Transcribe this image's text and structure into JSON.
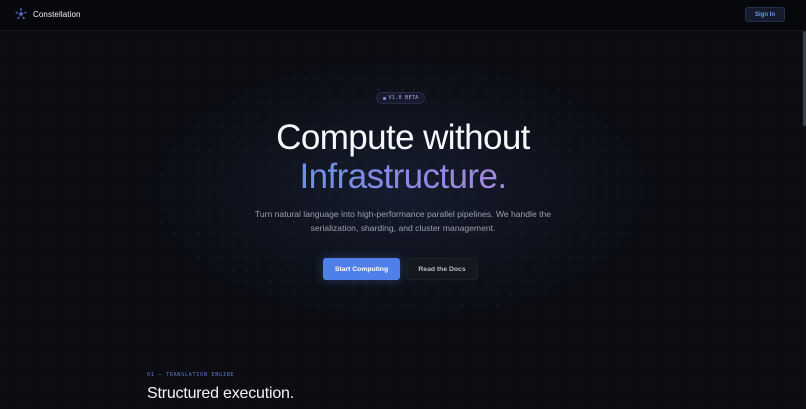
{
  "nav": {
    "brand_name": "Constellation",
    "brand_icon": "constellation-icon",
    "signin_label": "Sign In"
  },
  "hero": {
    "badge_text": "V1.0 BETA",
    "headline_line1": "Compute without",
    "headline_line2": "Infrastructure.",
    "subtext": "Turn natural language into high-performance parallel pipelines. We handle the serialization, sharding, and cluster management.",
    "primary_cta": "Start Computing",
    "secondary_cta": "Read the Docs"
  },
  "section": {
    "label": "01 — TRANSLATION ENGINE",
    "title": "Structured execution."
  },
  "colors": {
    "accent": "#4f7fe8",
    "gradient_start": "#6b90ea",
    "gradient_end": "#a688dc",
    "background": "#0b0d13"
  }
}
